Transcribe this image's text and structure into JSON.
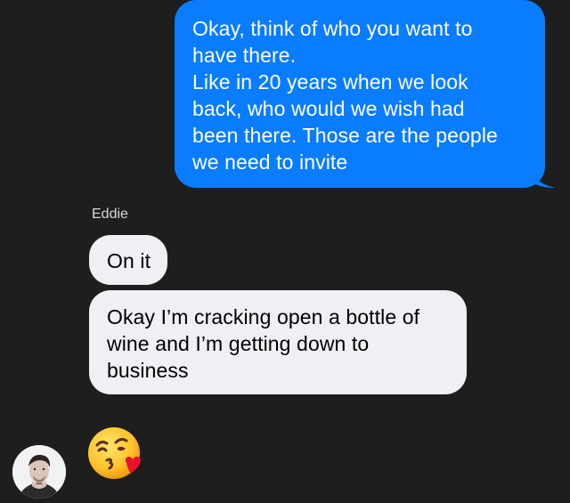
{
  "conversation": {
    "outgoing": {
      "lines": [
        "Okay, think of who you want to",
        "have there.",
        "Like in 20 years when we look",
        "back, who would we wish had",
        "been there. Those are the people",
        "we need to invite"
      ]
    },
    "sender_name": "Eddie",
    "incoming": [
      {
        "lines": [
          "On it"
        ]
      },
      {
        "lines": [
          "Okay I’m cracking open a bottle of",
          "wine and I’m getting down to",
          "business"
        ]
      }
    ],
    "reaction_emoji": "face-blowing-a-kiss-emoji",
    "avatar": "contact-avatar-photo"
  },
  "colors": {
    "background": "#1e1e1e",
    "outgoing_bubble": "#0a7cff",
    "incoming_bubble": "#efeff4"
  }
}
